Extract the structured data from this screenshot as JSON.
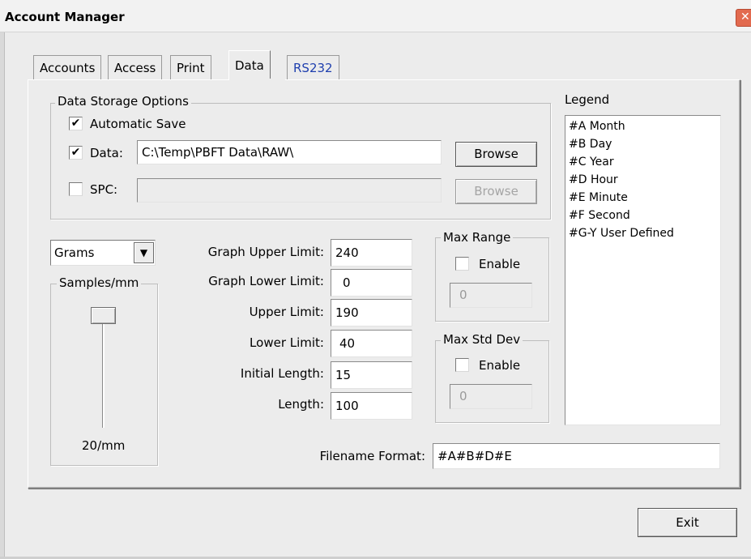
{
  "window": {
    "title": "Account Manager",
    "close_glyph": "✕"
  },
  "tabs": [
    {
      "label": "Accounts",
      "active": false
    },
    {
      "label": "Access",
      "active": false
    },
    {
      "label": "Print",
      "active": false
    },
    {
      "label": "Data",
      "active": true
    },
    {
      "label": "RS232",
      "active": false
    }
  ],
  "storage": {
    "group_label": "Data Storage Options",
    "automatic_save": {
      "label": "Automatic Save",
      "checked": true
    },
    "data": {
      "label": "Data:",
      "checked": true,
      "value": "C:\\Temp\\PBFT Data\\RAW\\",
      "browse": "Browse"
    },
    "spc": {
      "label": "SPC:",
      "checked": false,
      "value": "",
      "browse": "Browse"
    }
  },
  "units": {
    "selected": "Grams"
  },
  "samples": {
    "group_label": "Samples/mm",
    "value_label": "20/mm"
  },
  "limits": {
    "graph_upper": {
      "label": "Graph Upper Limit:",
      "value": "240"
    },
    "graph_lower": {
      "label": "Graph Lower Limit:",
      "value": "0"
    },
    "upper": {
      "label": "Upper Limit:",
      "value": "190"
    },
    "lower": {
      "label": "Lower Limit:",
      "value": "40"
    },
    "initial_length": {
      "label": "Initial Length:",
      "value": "15"
    },
    "length": {
      "label": "Length:",
      "value": "100"
    }
  },
  "max_range": {
    "group_label": "Max Range",
    "enable_label": "Enable",
    "checked": false,
    "value": "0"
  },
  "max_std_dev": {
    "group_label": "Max Std Dev",
    "enable_label": "Enable",
    "checked": false,
    "value": "0"
  },
  "legend": {
    "label": "Legend",
    "items": [
      "#A Month",
      "#B Day",
      "#C Year",
      "#D Hour",
      "#E Minute",
      "#F Second",
      "#G-Y User Defined"
    ]
  },
  "filename_format": {
    "label": "Filename Format:",
    "value": "#A#B#D#E"
  },
  "exit_button": "Exit",
  "check_glyph": "✔",
  "dropdown_glyph": "▼"
}
